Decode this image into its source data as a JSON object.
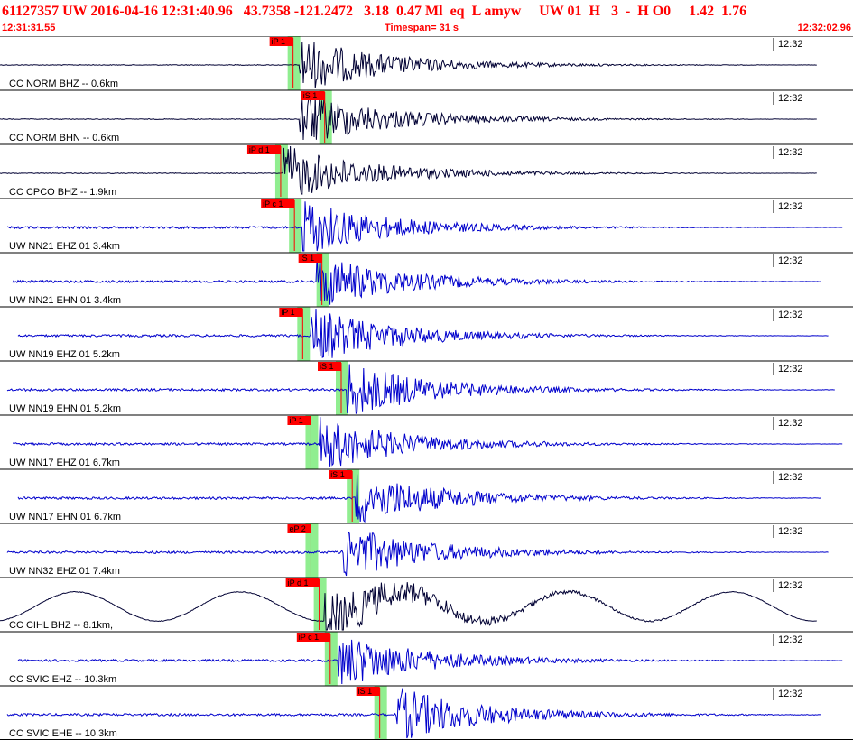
{
  "header": {
    "title": "61127357 UW 2016-04-16 12:31:40.96   43.7358 -121.2472   3.18  0.47 Ml  eq  L amyw     UW 01  H   3  -  H O0     1.42  1.76",
    "start_time": "12:31:31.55",
    "timespan": "Timespan=  31 s",
    "end_time": "12:32:02.96"
  },
  "colors": {
    "waveform_broadband": "#000033",
    "waveform_shortperiod": "#0000cc",
    "pick_flag": "#ff0000",
    "pick_window": "#90ee90",
    "header_text": "#ff0000"
  },
  "chart_data": {
    "type": "seismogram",
    "time_start": "12:31:31.55",
    "time_end": "12:32:02.96",
    "timespan_s": 31,
    "tick_label": "12:32",
    "traces": [
      {
        "label": "CC NORM BHZ -- 0.6km",
        "pick": "iP 1",
        "pick_t": 10.65,
        "color": "dark",
        "onset_t": 10.9,
        "p_arrival": 10.65
      },
      {
        "label": "CC NORM BHN -- 0.6km",
        "pick": "iS 1",
        "pick_t": 11.8,
        "color": "dark",
        "onset_t": 10.9,
        "p_arrival": 10.65
      },
      {
        "label": "CC CPCO BHZ -- 1.9km",
        "pick": "iP d 1",
        "pick_t": 10.2,
        "color": "dark",
        "onset_t": 10.3,
        "p_arrival": 10.2
      },
      {
        "label": "UW NN21 EHZ 01 3.4km",
        "pick": "iP c 1",
        "pick_t": 10.7,
        "color": "blue",
        "onset_t": 11.0,
        "p_arrival": 10.7
      },
      {
        "label": "UW NN21 EHN 01 3.4km",
        "pick": "iS 1",
        "pick_t": 11.7,
        "color": "blue",
        "onset_t": 11.5,
        "p_arrival": 10.7
      },
      {
        "label": "UW NN19 EHZ 01 5.2km",
        "pick": "iP 1",
        "pick_t": 11.0,
        "color": "blue",
        "onset_t": 11.3,
        "p_arrival": 11.0
      },
      {
        "label": "UW NN19 EHN 01 5.2km",
        "pick": "iS 1",
        "pick_t": 12.4,
        "color": "blue",
        "onset_t": 12.6,
        "p_arrival": 11.0
      },
      {
        "label": "UW NN17 EHZ 01 6.7km",
        "pick": "iP 1",
        "pick_t": 11.3,
        "color": "blue",
        "onset_t": 11.6,
        "p_arrival": 11.3
      },
      {
        "label": "UW NN17 EHN 01 6.7km",
        "pick": "iS 1",
        "pick_t": 12.8,
        "color": "blue",
        "onset_t": 12.9,
        "p_arrival": 11.3
      },
      {
        "label": "UW NN32 EHZ 01 7.4km",
        "pick": "eP 2",
        "pick_t": 11.3,
        "color": "blue",
        "onset_t": 12.4,
        "p_arrival": 11.3
      },
      {
        "label": "CC CIHL BHZ -- 8.1km,",
        "pick": "iP d 1",
        "pick_t": 11.6,
        "color": "dark",
        "onset_t": 11.8,
        "p_arrival": 11.6
      },
      {
        "label": "CC SVIC EHZ -- 10.3km",
        "pick": "iP c 1",
        "pick_t": 12.0,
        "color": "blue",
        "onset_t": 12.3,
        "p_arrival": 12.0
      },
      {
        "label": "CC SVIC EHE -- 10.3km",
        "pick": "iS 1",
        "pick_t": 13.8,
        "color": "blue",
        "onset_t": 14.4,
        "p_arrival": 12.0
      }
    ]
  }
}
